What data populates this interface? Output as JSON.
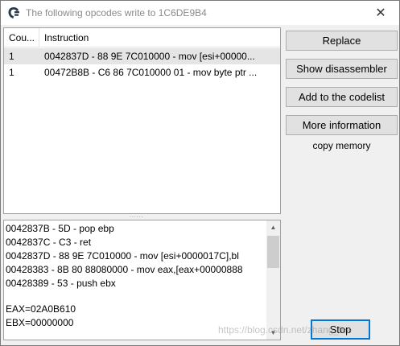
{
  "window": {
    "title": "The following opcodes write to 1C6DE9B4",
    "close_glyph": "✕"
  },
  "list": {
    "columns": [
      "Cou...",
      "Instruction"
    ],
    "rows": [
      {
        "count": "1",
        "instruction": "0042837D - 88 9E 7C010000  - mov [esi+00000...",
        "selected": true
      },
      {
        "count": "1",
        "instruction": "00472B8B - C6 86 7C010000 01 - mov byte ptr ...",
        "selected": false
      }
    ]
  },
  "buttons": {
    "replace": "Replace",
    "show_disassembler": "Show disassembler",
    "add_to_codelist": "Add to the codelist",
    "more_information": "More information",
    "copy_memory": "copy memory",
    "stop": "Stop"
  },
  "splitter_glyph": "......",
  "disassembly": {
    "lines": [
      "0042837B - 5D - pop ebp",
      "0042837C - C3 - ret",
      "0042837D - 88 9E 7C010000  - mov [esi+0000017C],bl",
      "00428383 - 8B 80 88080000  - mov eax,[eax+00000888",
      "00428389 - 53 - push ebx"
    ],
    "registers": [
      "EAX=02A0B610",
      "EBX=00000000"
    ]
  },
  "watermark": "https://blog.csdn.net/zhang_lee",
  "icons": {
    "app": "cheat-engine-icon",
    "close": "close-icon"
  },
  "colors": {
    "accent": "#0078d7",
    "selection": "#e5e5e5"
  }
}
